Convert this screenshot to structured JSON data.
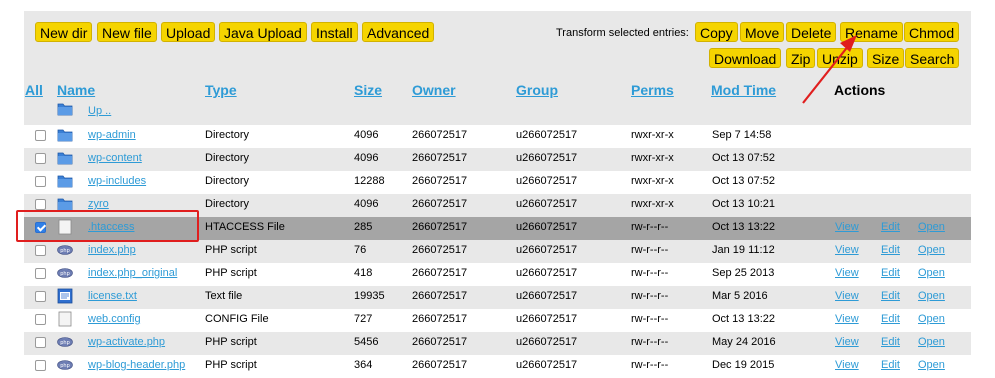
{
  "toolbar": {
    "buttons": [
      "New dir",
      "New file",
      "Upload",
      "Java Upload",
      "Install",
      "Advanced"
    ],
    "transform_label": "Transform selected entries:",
    "transform_row1": [
      "Copy",
      "Move",
      "Delete",
      "Rename",
      "Chmod"
    ],
    "transform_row2": [
      "Download",
      "Zip",
      "Unzip",
      "Size",
      "Search"
    ]
  },
  "headers": {
    "all": "All",
    "name": "Name",
    "type": "Type",
    "size": "Size",
    "owner": "Owner",
    "group": "Group",
    "perms": "Perms",
    "modtime": "Mod Time",
    "actions": "Actions"
  },
  "up_row": {
    "name": "Up .."
  },
  "action_labels": {
    "view": "View",
    "edit": "Edit",
    "open": "Open"
  },
  "rows": [
    {
      "name": "wp-admin",
      "type": "Directory",
      "size": "4096",
      "owner": "266072517",
      "group": "u266072517",
      "perms": "rwxr-xr-x",
      "mod": "Sep 7 14:58",
      "icon": "folder-icon",
      "checked": false,
      "actions": false
    },
    {
      "name": "wp-content",
      "type": "Directory",
      "size": "4096",
      "owner": "266072517",
      "group": "u266072517",
      "perms": "rwxr-xr-x",
      "mod": "Oct 13 07:52",
      "icon": "folder-icon",
      "checked": false,
      "actions": false
    },
    {
      "name": "wp-includes",
      "type": "Directory",
      "size": "12288",
      "owner": "266072517",
      "group": "u266072517",
      "perms": "rwxr-xr-x",
      "mod": "Oct 13 07:52",
      "icon": "folder-icon",
      "checked": false,
      "actions": false
    },
    {
      "name": "zyro",
      "type": "Directory",
      "size": "4096",
      "owner": "266072517",
      "group": "u266072517",
      "perms": "rwxr-xr-x",
      "mod": "Oct 13 10:21",
      "icon": "folder-icon",
      "checked": false,
      "actions": false
    },
    {
      "name": ".htaccess",
      "type": "HTACCESS File",
      "size": "285",
      "owner": "266072517",
      "group": "u266072517",
      "perms": "rw-r--r--",
      "mod": "Oct 13 13:22",
      "icon": "file-icon",
      "checked": true,
      "actions": true
    },
    {
      "name": "index.php",
      "type": "PHP script",
      "size": "76",
      "owner": "266072517",
      "group": "u266072517",
      "perms": "rw-r--r--",
      "mod": "Jan 19 11:12",
      "icon": "php-icon",
      "checked": false,
      "actions": true
    },
    {
      "name": "index.php_original",
      "type": "PHP script",
      "size": "418",
      "owner": "266072517",
      "group": "u266072517",
      "perms": "rw-r--r--",
      "mod": "Sep 25 2013",
      "icon": "php-icon",
      "checked": false,
      "actions": true
    },
    {
      "name": "license.txt",
      "type": "Text file",
      "size": "19935",
      "owner": "266072517",
      "group": "u266072517",
      "perms": "rw-r--r--",
      "mod": "Mar 5 2016",
      "icon": "text-file-icon",
      "checked": false,
      "actions": true
    },
    {
      "name": "web.config",
      "type": "CONFIG File",
      "size": "727",
      "owner": "266072517",
      "group": "u266072517",
      "perms": "rw-r--r--",
      "mod": "Oct 13 13:22",
      "icon": "file-icon",
      "checked": false,
      "actions": true
    },
    {
      "name": "wp-activate.php",
      "type": "PHP script",
      "size": "5456",
      "owner": "266072517",
      "group": "u266072517",
      "perms": "rw-r--r--",
      "mod": "May 24 2016",
      "icon": "php-icon",
      "checked": false,
      "actions": true
    },
    {
      "name": "wp-blog-header.php",
      "type": "PHP script",
      "size": "364",
      "owner": "266072517",
      "group": "u266072517",
      "perms": "rw-r--r--",
      "mod": "Dec 19 2015",
      "icon": "php-icon",
      "checked": false,
      "actions": true
    }
  ],
  "colors": {
    "button": "#f5d400",
    "link": "#2e9bd6",
    "selected_row": "#a5a5a5",
    "panel": "#e8e8e8",
    "highlight": "#e01e1e"
  }
}
